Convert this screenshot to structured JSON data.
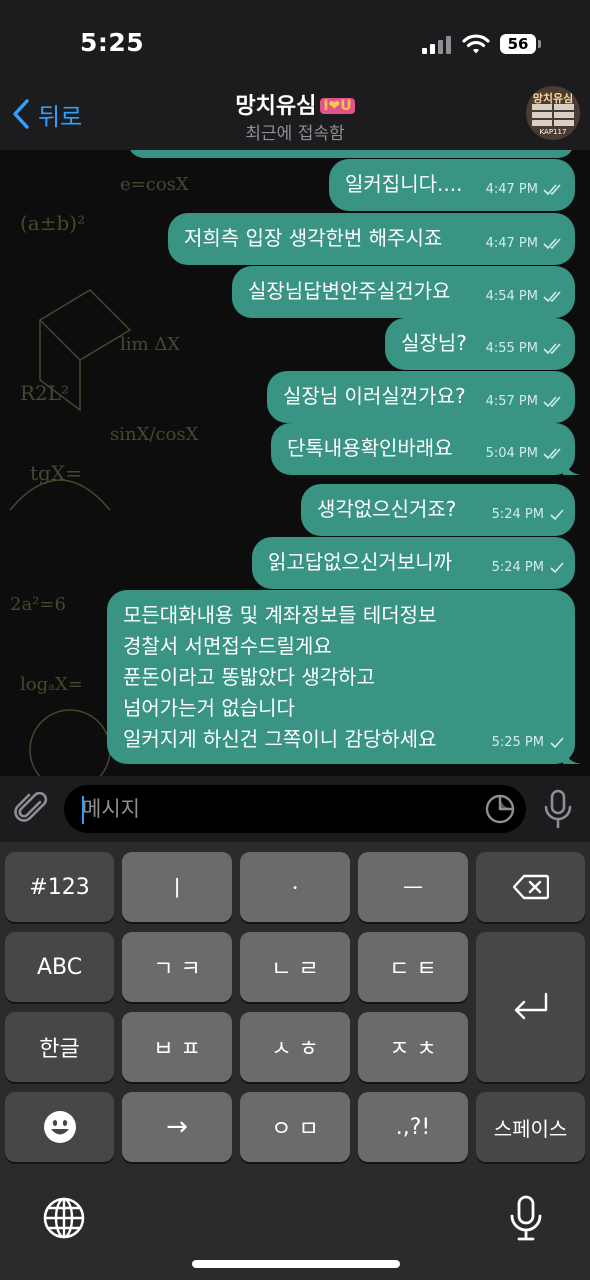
{
  "status_bar": {
    "time": "5:25",
    "battery": "56"
  },
  "header": {
    "back_label": "뒤로",
    "title": "망치유심",
    "title_emoji": "I❤U",
    "subtitle": "최근에 접속함",
    "avatar_text_top": "망치유심",
    "avatar_text_bottom": "KAP117"
  },
  "messages": [
    {
      "text": "일커집니다....",
      "time": "4:47 PM",
      "status": "read"
    },
    {
      "text": "저희측 입장 생각한번 해주시죠",
      "time": "4:47 PM",
      "status": "read"
    },
    {
      "text": "실장님답변안주실건가요",
      "time": "4:54 PM",
      "status": "read"
    },
    {
      "text": "실장님?",
      "time": "4:55 PM",
      "status": "read"
    },
    {
      "text": "실장님 이러실껀가요?",
      "time": "4:57 PM",
      "status": "read"
    },
    {
      "text": "단톡내용확인바래요",
      "time": "5:04 PM",
      "status": "read"
    },
    {
      "text": "생각없으신거죠?",
      "time": "5:24 PM",
      "status": "sent"
    },
    {
      "text": "읽고답없으신거보니까",
      "time": "5:24 PM",
      "status": "sent"
    },
    {
      "lines": [
        "모든대화내용 및 계좌정보들 테더정보",
        "경찰서 서면접수드릴게요",
        "푼돈이라고 똥밟았다 생각하고",
        "넘어가는거 없습니다",
        "일커지게 하신건 그쪽이니 감당하세요"
      ],
      "time": "5:25 PM",
      "status": "sent"
    }
  ],
  "input": {
    "placeholder": "메시지",
    "value": ""
  },
  "keyboard": {
    "row1": [
      "#123",
      "ㅣ",
      "ㆍ",
      "ㅡ",
      "backspace-icon"
    ],
    "row2": [
      "ABC",
      "ㄱ ㅋ",
      "ㄴ ㄹ",
      "ㄷ ㅌ"
    ],
    "row3": [
      "한글",
      "ㅂ ㅍ",
      "ㅅ ㅎ",
      "ㅈ ㅊ"
    ],
    "row4": [
      "emoji-icon",
      "→",
      "ㅇ ㅁ",
      ".,?!",
      "스페이스"
    ],
    "return_icon": "return-icon",
    "bottom_icons": [
      "globe-icon",
      "microphone-icon"
    ]
  },
  "colors": {
    "bubble": "#3a9484",
    "accent": "#2f9fff",
    "bar": "#1c1c1e"
  }
}
